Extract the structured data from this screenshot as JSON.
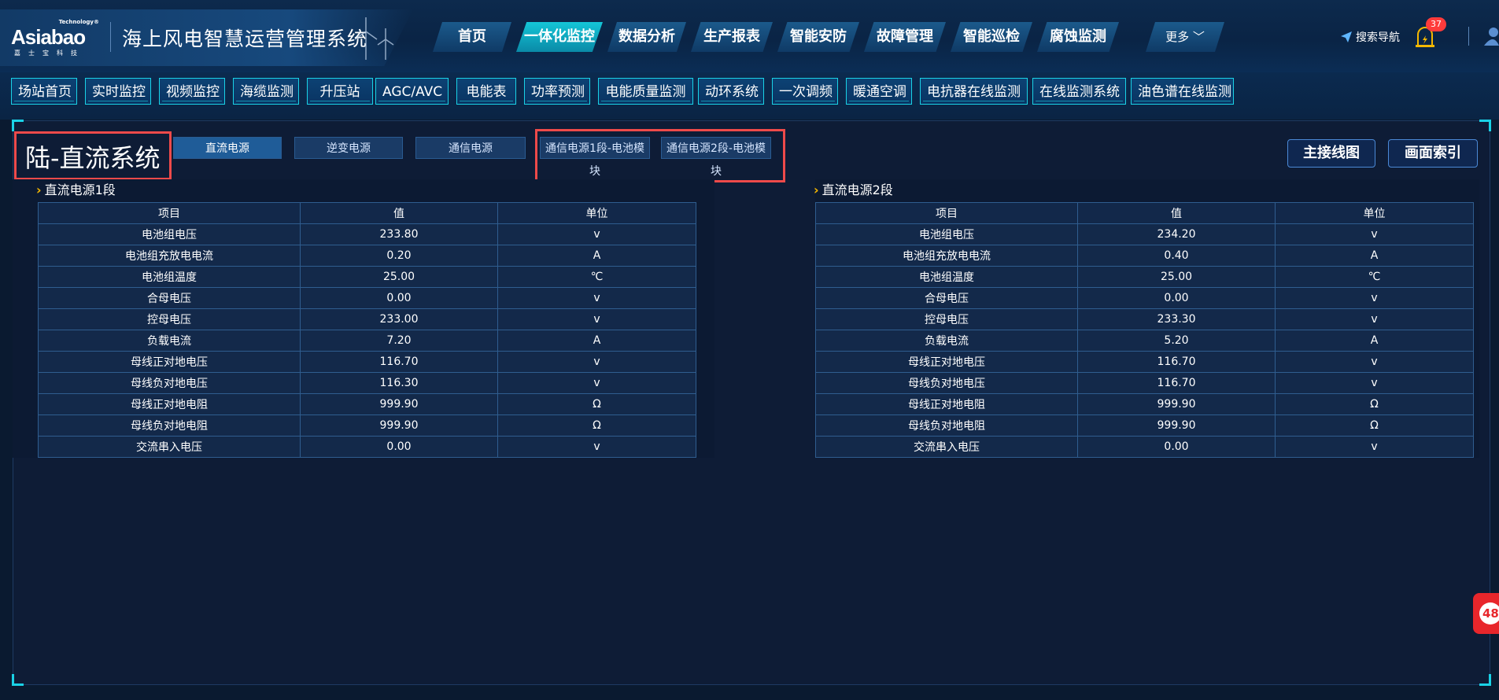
{
  "header": {
    "logo": {
      "tech": "Technology®",
      "brand": "Asiabao",
      "sub": "嘉士宝科技"
    },
    "title": "海上风电智慧运营管理系统",
    "nav": [
      {
        "label": "首页"
      },
      {
        "label": "一体化监控"
      },
      {
        "label": "数据分析"
      },
      {
        "label": "生产报表"
      },
      {
        "label": "智能安防"
      },
      {
        "label": "故障管理"
      },
      {
        "label": "智能巡检"
      },
      {
        "label": "腐蚀监测"
      },
      {
        "label": "更多"
      }
    ],
    "active_nav": "一体化监控",
    "search_nav": "搜索导航",
    "alarm_count": "37"
  },
  "subnav": [
    {
      "label": "场站首页"
    },
    {
      "label": "实时监控"
    },
    {
      "label": "视频监控"
    },
    {
      "label": "海缆监测"
    },
    {
      "label": "升压站"
    },
    {
      "label": "AGC/AVC"
    },
    {
      "label": "电能表"
    },
    {
      "label": "功率预测"
    },
    {
      "label": "电能质量监测"
    },
    {
      "label": "动环系统"
    },
    {
      "label": "一次调频"
    },
    {
      "label": "暖通空调"
    },
    {
      "label": "电抗器在线监测"
    },
    {
      "label": "在线监测系统"
    },
    {
      "label": "油色谱在线监测"
    }
  ],
  "page": {
    "title": "陆-直流系统",
    "tabs": [
      {
        "label": "直流电源"
      },
      {
        "label": "逆变电源"
      },
      {
        "label": "通信电源"
      }
    ],
    "tabs_highlighted": [
      {
        "label": "通信电源1段-电池模",
        "tail": "块"
      },
      {
        "label": "通信电源2段-电池模",
        "tail": "块"
      }
    ],
    "buttons": {
      "main_wiring": "主接线图",
      "screen_index": "画面索引"
    },
    "float_badge": "48"
  },
  "columns": [
    "项目",
    "值",
    "单位"
  ],
  "section1": {
    "title": "直流电源1段",
    "rows": [
      [
        "电池组电压",
        "233.80",
        "v"
      ],
      [
        "电池组充放电电流",
        "0.20",
        "A"
      ],
      [
        "电池组温度",
        "25.00",
        "℃"
      ],
      [
        "合母电压",
        "0.00",
        "v"
      ],
      [
        "控母电压",
        "233.00",
        "v"
      ],
      [
        "负载电流",
        "7.20",
        "A"
      ],
      [
        "母线正对地电压",
        "116.70",
        "v"
      ],
      [
        "母线负对地电压",
        "116.30",
        "v"
      ],
      [
        "母线正对地电阻",
        "999.90",
        "Ω"
      ],
      [
        "母线负对地电阻",
        "999.90",
        "Ω"
      ],
      [
        "交流串入电压",
        "0.00",
        "v"
      ]
    ]
  },
  "section2": {
    "title": "直流电源2段",
    "rows": [
      [
        "电池组电压",
        "234.20",
        "v"
      ],
      [
        "电池组充放电电流",
        "0.40",
        "A"
      ],
      [
        "电池组温度",
        "25.00",
        "℃"
      ],
      [
        "合母电压",
        "0.00",
        "v"
      ],
      [
        "控母电压",
        "233.30",
        "v"
      ],
      [
        "负载电流",
        "5.20",
        "A"
      ],
      [
        "母线正对地电压",
        "116.70",
        "v"
      ],
      [
        "母线负对地电压",
        "116.70",
        "v"
      ],
      [
        "母线正对地电阻",
        "999.90",
        "Ω"
      ],
      [
        "母线负对地电阻",
        "999.90",
        "Ω"
      ],
      [
        "交流串入电压",
        "0.00",
        "v"
      ]
    ]
  },
  "colors": {
    "accent": "#1ad2e6",
    "highlight_box": "#ee4a4a",
    "active_nav": "#14c6d7"
  }
}
